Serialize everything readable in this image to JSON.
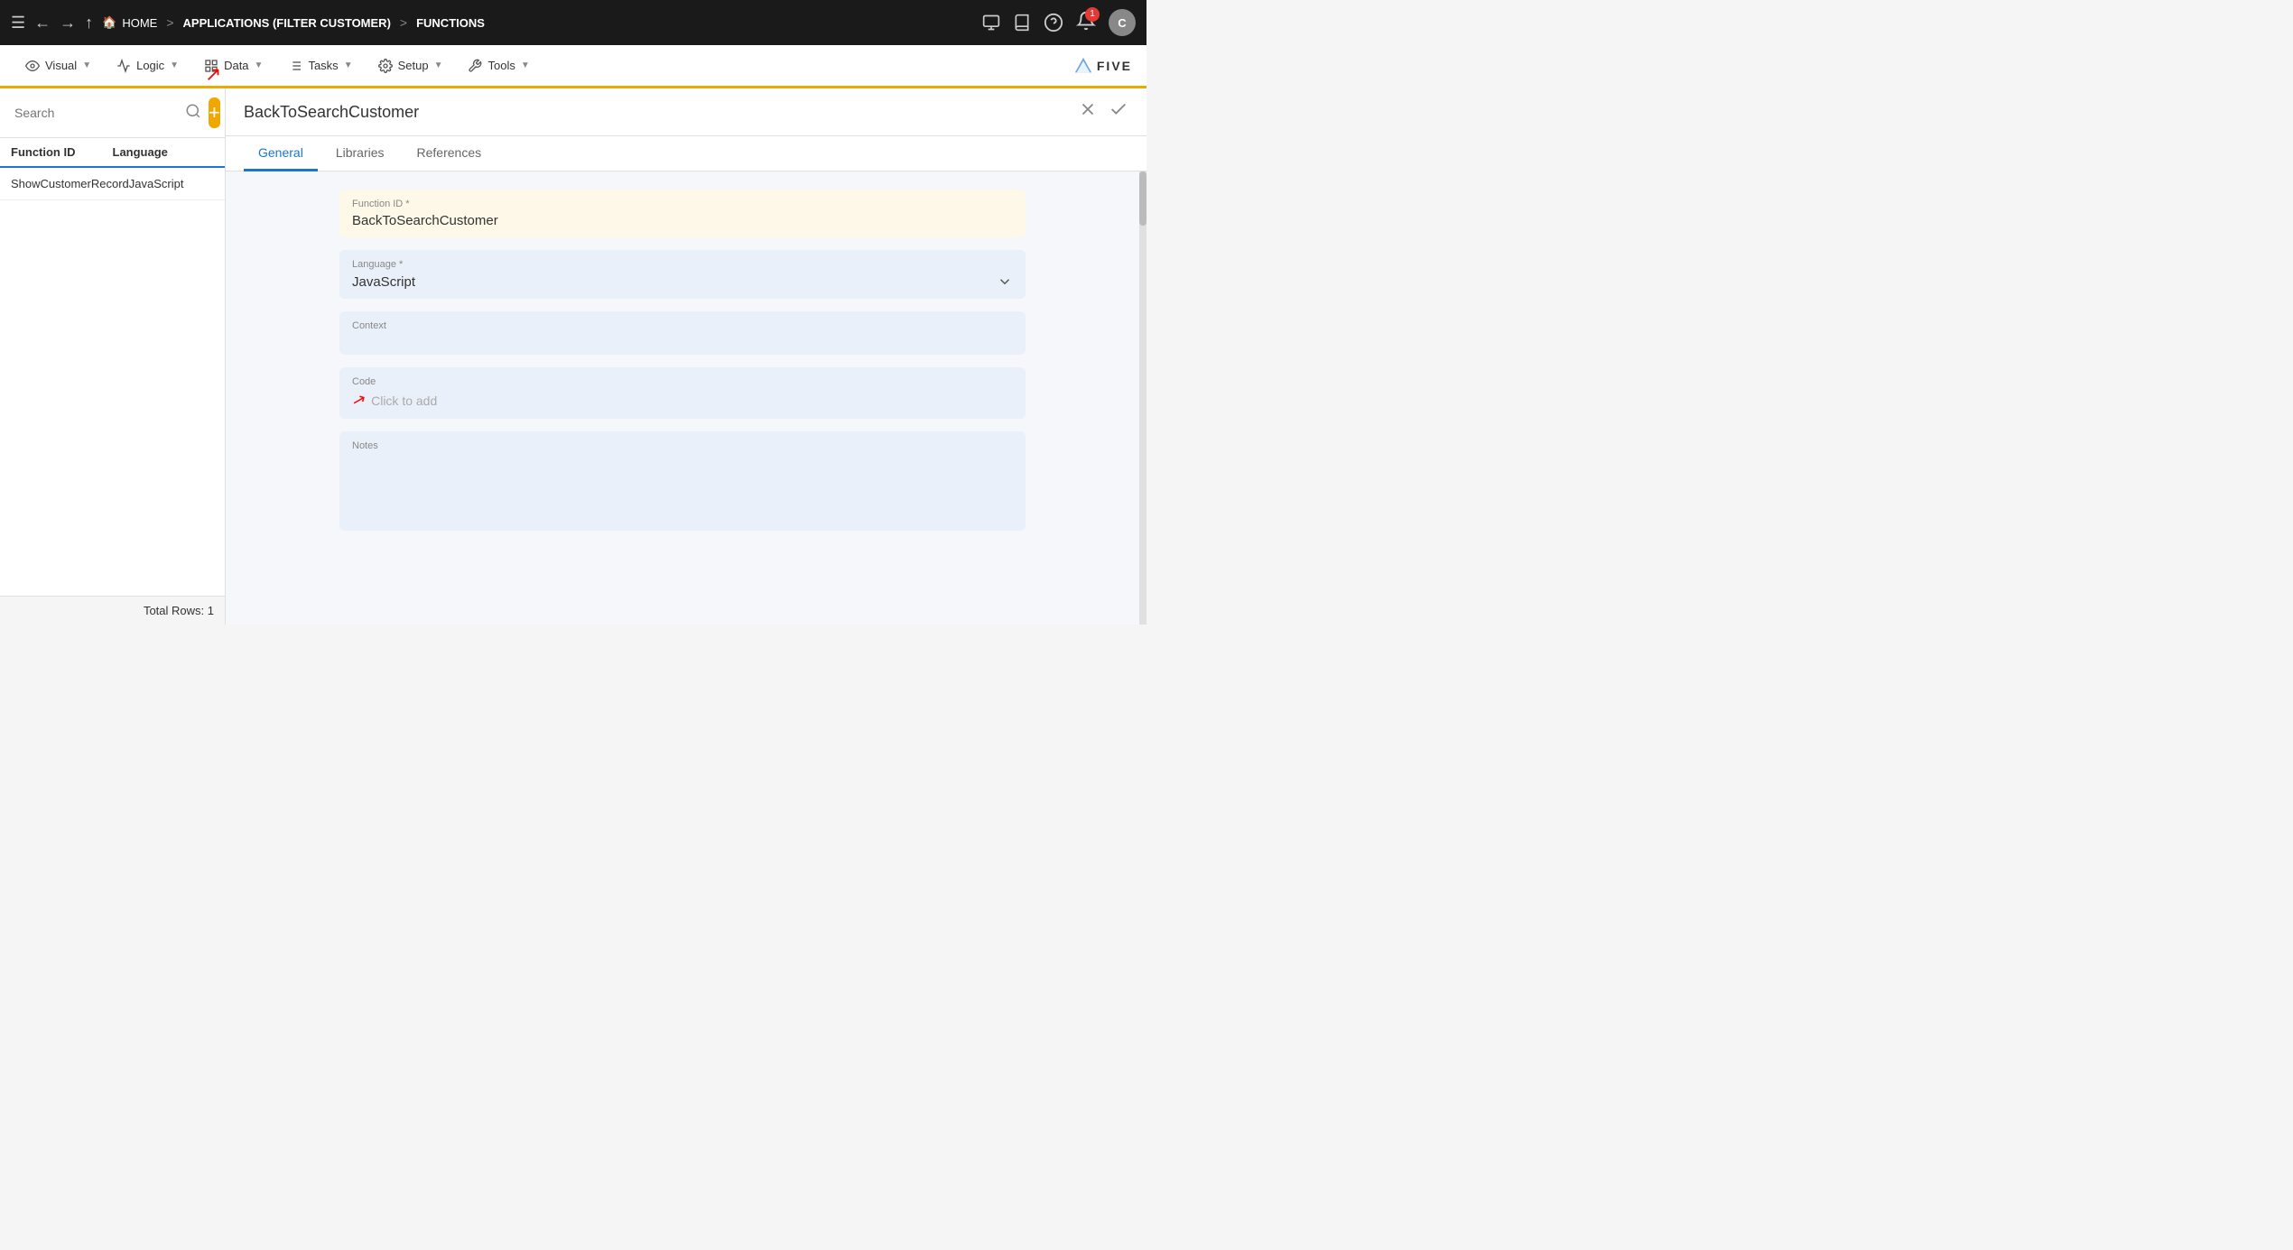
{
  "topNav": {
    "menuIcon": "☰",
    "backIcon": "←",
    "forwardIcon": "→",
    "upIcon": "↑",
    "homeIcon": "🏠",
    "homeLabel": "HOME",
    "separator1": ">",
    "breadcrumb1": "APPLICATIONS (FILTER CUSTOMER)",
    "separator2": ">",
    "breadcrumb2": "FUNCTIONS",
    "rightIcons": {
      "monitor": "⊙",
      "books": "📚",
      "help": "?",
      "bell": "🔔",
      "notificationCount": "1",
      "avatarLabel": "C"
    }
  },
  "secondNav": {
    "items": [
      {
        "id": "visual",
        "icon": "👁",
        "label": "Visual"
      },
      {
        "id": "logic",
        "icon": "⚡",
        "label": "Logic"
      },
      {
        "id": "data",
        "icon": "▦",
        "label": "Data"
      },
      {
        "id": "tasks",
        "icon": "≡",
        "label": "Tasks"
      },
      {
        "id": "setup",
        "icon": "⚙",
        "label": "Setup"
      },
      {
        "id": "tools",
        "icon": "✂",
        "label": "Tools"
      }
    ],
    "logoText": "FIVE"
  },
  "leftPanel": {
    "searchPlaceholder": "Search",
    "addBtnLabel": "+",
    "tableHeaders": {
      "functionId": "Function ID",
      "language": "Language"
    },
    "rows": [
      {
        "functionId": "ShowCustomerRecord",
        "language": "JavaScript"
      }
    ],
    "footer": "Total Rows: 1"
  },
  "rightPanel": {
    "title": "BackToSearchCustomer",
    "tabs": [
      {
        "id": "general",
        "label": "General"
      },
      {
        "id": "libraries",
        "label": "Libraries"
      },
      {
        "id": "references",
        "label": "References"
      }
    ],
    "activeTab": "general",
    "form": {
      "functionIdLabel": "Function ID *",
      "functionIdValue": "BackToSearchCustomer",
      "languageLabel": "Language *",
      "languageValue": "JavaScript",
      "contextLabel": "Context",
      "contextValue": "",
      "codeLabel": "Code",
      "codePlaceholder": "Click to add",
      "notesLabel": "Notes"
    }
  }
}
